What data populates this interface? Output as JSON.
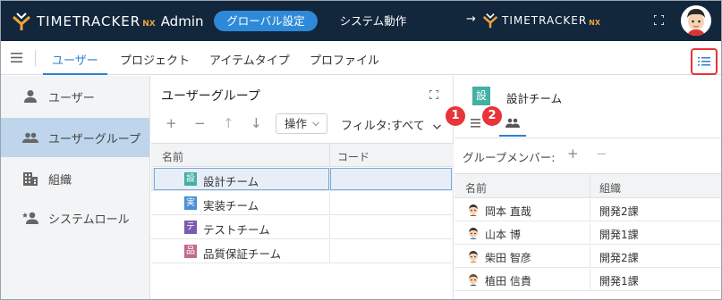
{
  "header": {
    "logo_text": "TIMETRACKER",
    "logo_nx": "NX",
    "logo_admin": "Admin",
    "tabs": [
      {
        "label": "グローバル設定",
        "active": true
      },
      {
        "label": "システム動作",
        "active": false
      }
    ],
    "arrow": "→",
    "logo2_text": "TIMETRACKER",
    "logo2_nx": "NX",
    "accent_color": "#2e8ad8",
    "brand_orange": "#f0a33a",
    "bar_color": "#12263c"
  },
  "nav": {
    "tabs": [
      {
        "label": "ユーザー",
        "active": true
      },
      {
        "label": "プロジェクト",
        "active": false
      },
      {
        "label": "アイテムタイプ",
        "active": false
      },
      {
        "label": "プロファイル",
        "active": false
      }
    ]
  },
  "sidebar": {
    "items": [
      {
        "label": "ユーザー",
        "icon": "person-icon",
        "active": false
      },
      {
        "label": "ユーザーグループ",
        "icon": "group-icon",
        "active": true
      },
      {
        "label": "組織",
        "icon": "building-icon",
        "active": false
      },
      {
        "label": "システムロール",
        "icon": "role-icon",
        "active": false
      }
    ]
  },
  "middle": {
    "title": "ユーザーグループ",
    "toolbar": {
      "add": "+",
      "remove": "−",
      "up": "↑",
      "down": "↓",
      "operation_label": "操作",
      "filter_label": "フィルタ:すべて"
    },
    "columns": [
      "名前",
      "コード"
    ],
    "rows": [
      {
        "icon_char": "設",
        "icon_color": "#42b0a3",
        "name": "設計チーム",
        "code": "",
        "selected": true
      },
      {
        "icon_char": "実",
        "icon_color": "#4a8fd6",
        "name": "実装チーム",
        "code": "",
        "selected": false
      },
      {
        "icon_char": "テ",
        "icon_color": "#7b5bb0",
        "name": "テストチーム",
        "code": "",
        "selected": false
      },
      {
        "icon_char": "品",
        "icon_color": "#c46a8e",
        "name": "品質保証チーム",
        "code": "",
        "selected": false
      }
    ]
  },
  "right": {
    "icon_char": "設",
    "title": "設計チーム",
    "group_members_label": "グループメンバー:",
    "add": "+",
    "remove": "−",
    "columns": [
      "名前",
      "組織"
    ],
    "members": [
      {
        "name": "岡本 直哉",
        "org": "開発2課"
      },
      {
        "name": "山本 博",
        "org": "開発1課"
      },
      {
        "name": "柴田 智彦",
        "org": "開発2課"
      },
      {
        "name": "植田 信貴",
        "org": "開発1課"
      }
    ]
  },
  "callouts": [
    "1",
    "2"
  ]
}
